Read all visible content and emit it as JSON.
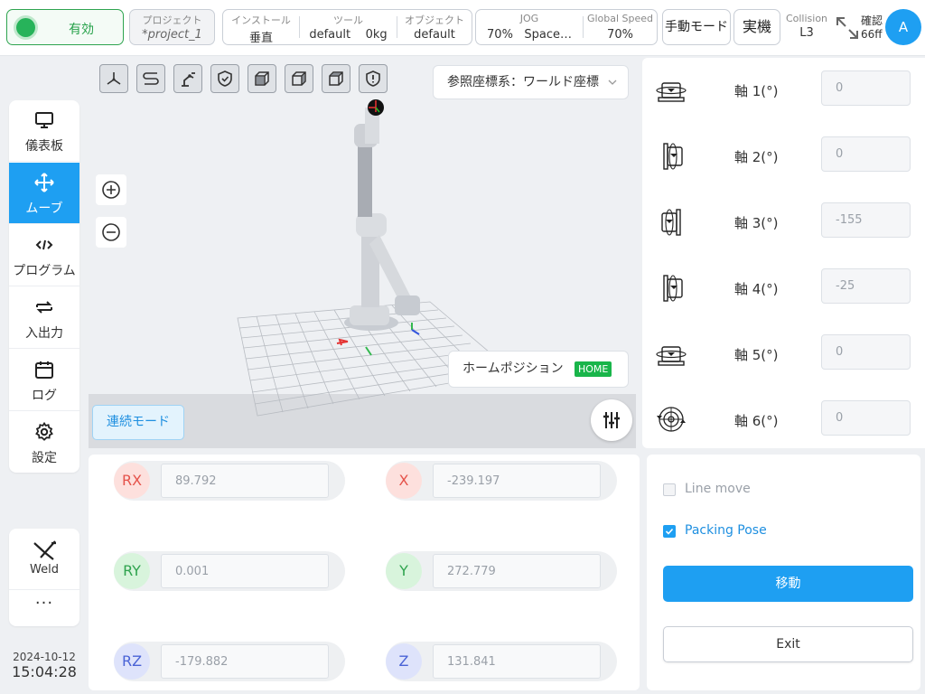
{
  "topbar": {
    "enabled_label": "有効",
    "project": {
      "caption": "プロジェクト",
      "value": "*project_1"
    },
    "install": {
      "caption": "インストール",
      "value": "垂直"
    },
    "tool": {
      "caption": "ツール",
      "value_name": "default",
      "value_load": "0kg"
    },
    "object": {
      "caption": "オブジェクト",
      "value": "default"
    },
    "jog": {
      "caption": "JOG",
      "speed": "70%",
      "space": "Space…"
    },
    "global_speed": {
      "caption": "Global Speed",
      "value": "70%"
    },
    "manual_mode": "手動モード",
    "real_machine": "実機",
    "collision": {
      "caption": "Collision",
      "value": "L3"
    },
    "confirm": {
      "line1": "確認",
      "line2": "66ff"
    },
    "avatar": "A"
  },
  "nav": {
    "items": [
      {
        "label": "儀表板",
        "icon": "monitor-icon"
      },
      {
        "label": "ムーブ",
        "icon": "move-arrows-icon"
      },
      {
        "label": "プログラム",
        "icon": "code-icon"
      },
      {
        "label": "入出力",
        "icon": "swap-icon"
      },
      {
        "label": "ログ",
        "icon": "calendar-icon"
      },
      {
        "label": "設定",
        "icon": "gear-icon"
      }
    ],
    "weld_label": "Weld",
    "more_label": "···",
    "date": "2024-10-12",
    "time": "15:04:28"
  },
  "viewport": {
    "reference_frame": "参照座標系：ワールド座標",
    "home_position": "ホームポジション",
    "home_badge": "HOME",
    "continuous_mode": "連続モード"
  },
  "joints": [
    {
      "label": "軸 1(°)",
      "value": "0"
    },
    {
      "label": "軸 2(°)",
      "value": "0"
    },
    {
      "label": "軸 3(°)",
      "value": "-155"
    },
    {
      "label": "軸 4(°)",
      "value": "-25"
    },
    {
      "label": "軸 5(°)",
      "value": "0"
    },
    {
      "label": "軸 6(°)",
      "value": "0"
    }
  ],
  "coords": {
    "rx": {
      "label": "RX",
      "value": "89.792"
    },
    "ry": {
      "label": "RY",
      "value": "0.001"
    },
    "rz": {
      "label": "RZ",
      "value": "-179.882"
    },
    "x": {
      "label": "X",
      "value": "-239.197"
    },
    "y": {
      "label": "Y",
      "value": "272.779"
    },
    "z": {
      "label": "Z",
      "value": "131.841"
    }
  },
  "move_panel": {
    "line_move": "Line move",
    "packing_pose": "Packing Pose",
    "move_button": "移動",
    "exit_button": "Exit"
  },
  "colors": {
    "accent": "#1e9ff2",
    "enabled": "#27b35a",
    "home_badge": "#19b54a"
  }
}
